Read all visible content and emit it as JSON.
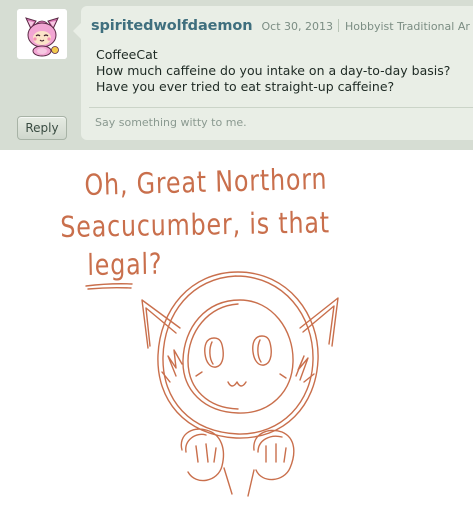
{
  "comment": {
    "username": "spiritedwolfdaemon",
    "date": "Oct 30, 2013",
    "user_type": "Hobbyist Traditional Ar",
    "body_lines": [
      "CoffeeCat",
      "How much caffeine do you intake on a day-to-day basis?",
      "Have you ever tried to eat straight-up caffeine?"
    ],
    "reply_button_label": "Reply",
    "reply_placeholder": "Say something witty to me."
  },
  "drawing": {
    "text_lines": [
      "Oh, Great Northorn",
      "Seacucumber, is that",
      "legal?"
    ],
    "ink_color": "#c96f4c"
  },
  "colors": {
    "panel_bg": "#d6ddd3",
    "bubble_bg": "#e9eee6",
    "username": "#3f6f7e"
  }
}
